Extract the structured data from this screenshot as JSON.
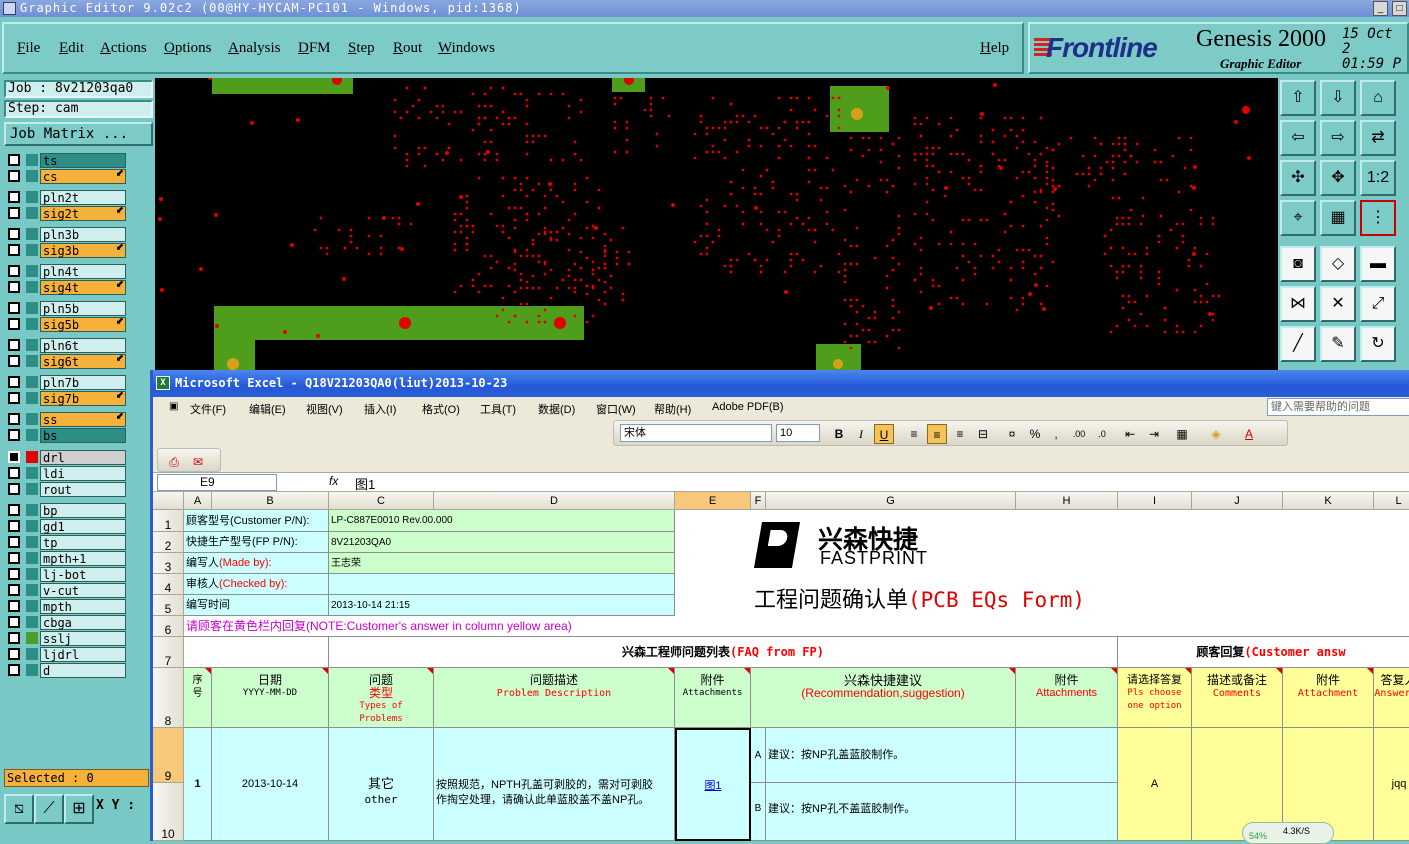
{
  "genesis": {
    "title": "Graphic Editor 9.02c2 (00@HY-HYCAM-PC101 - Windows, pid:1368)",
    "menu": [
      "File",
      "Edit",
      "Actions",
      "Options",
      "Analysis",
      "DFM",
      "Step",
      "Rout",
      "Windows"
    ],
    "help": "Help",
    "brand": "Frontline",
    "product": "Genesis 2000",
    "subtitle": "Graphic Editor",
    "date": "15 Oct 2",
    "time": "01:59 P",
    "job": "Job : 8v21203qa0",
    "step": "Step: cam",
    "job_matrix": "Job Matrix ...",
    "layers": [
      {
        "name": "ts",
        "color": "#2c8e84",
        "arrow": false
      },
      {
        "name": "cs",
        "color": "#f6b13a",
        "arrow": true
      },
      {
        "name": "pln2t",
        "color": "#cfeeee",
        "arrow": false
      },
      {
        "name": "sig2t",
        "color": "#f6b13a",
        "arrow": true
      },
      {
        "name": "pln3b",
        "color": "#cfeeee",
        "arrow": false
      },
      {
        "name": "sig3b",
        "color": "#f6b13a",
        "arrow": true
      },
      {
        "name": "pln4t",
        "color": "#cfeeee",
        "arrow": false
      },
      {
        "name": "sig4t",
        "color": "#f6b13a",
        "arrow": true
      },
      {
        "name": "pln5b",
        "color": "#cfeeee",
        "arrow": false
      },
      {
        "name": "sig5b",
        "color": "#f6b13a",
        "arrow": true
      },
      {
        "name": "pln6t",
        "color": "#cfeeee",
        "arrow": false
      },
      {
        "name": "sig6t",
        "color": "#f6b13a",
        "arrow": true
      },
      {
        "name": "pln7b",
        "color": "#cfeeee",
        "arrow": false
      },
      {
        "name": "sig7b",
        "color": "#f6b13a",
        "arrow": true
      },
      {
        "name": "ss",
        "color": "#f6b13a",
        "arrow": true
      },
      {
        "name": "bs",
        "color": "#2c8e84",
        "arrow": false
      },
      {
        "name": "drl",
        "color": "#cfcfcf",
        "arrow": false,
        "active": true
      },
      {
        "name": "ldi",
        "color": "#cfeeee",
        "arrow": false
      },
      {
        "name": "rout",
        "color": "#cfeeee",
        "arrow": false
      },
      {
        "name": "bp",
        "color": "#cfeeee",
        "arrow": false
      },
      {
        "name": "gd1",
        "color": "#cfeeee",
        "arrow": false
      },
      {
        "name": "tp",
        "color": "#cfeeee",
        "arrow": false
      },
      {
        "name": "mpth+1",
        "color": "#cfeeee",
        "arrow": false
      },
      {
        "name": "lj-bot",
        "color": "#cfeeee",
        "arrow": false
      },
      {
        "name": "v-cut",
        "color": "#cfeeee",
        "arrow": false
      },
      {
        "name": "mpth",
        "color": "#cfeeee",
        "arrow": false
      },
      {
        "name": "cbga",
        "color": "#cfeeee",
        "arrow": false
      },
      {
        "name": "sslj",
        "color": "#cfeeee",
        "arrow": false
      },
      {
        "name": "ljdrl",
        "color": "#cfeeee",
        "arrow": false
      },
      {
        "name": "d",
        "color": "#cfeeee",
        "arrow": false
      }
    ],
    "selected": "Selected : 0",
    "xy": "X Y :"
  },
  "excel": {
    "title": "Microsoft Excel - Q18V21203QA0(liut)2013-10-23",
    "menu": [
      "文件(F)",
      "编辑(E)",
      "视图(V)",
      "插入(I)",
      "格式(O)",
      "工具(T)",
      "数据(D)",
      "窗口(W)",
      "帮助(H)",
      "Adobe PDF(B)"
    ],
    "help_placeholder": "键入需要帮助的问题",
    "font": "宋体",
    "size": "10",
    "namebox": "E9",
    "fx": "fx",
    "formula": "图1",
    "columns": [
      "A",
      "B",
      "C",
      "D",
      "E",
      "F",
      "G",
      "H",
      "I",
      "J",
      "K",
      "L"
    ],
    "rows": [
      "1",
      "2",
      "3",
      "4",
      "5",
      "6",
      "7",
      "8",
      "9",
      "10"
    ],
    "info": [
      {
        "label": "顾客型号(Customer P/N):",
        "value": "LP-C887E0010 Rev.00.000"
      },
      {
        "label": "快捷生产型号(FP P/N):",
        "value": "8V21203QA0"
      },
      {
        "label": "编写人",
        "label_en": "(Made by):",
        "value": "王志荣"
      },
      {
        "label": "审核人",
        "label_en": "(Checked by):",
        "value": ""
      },
      {
        "label": "编写时间",
        "value": "2013-10-14 21:15"
      }
    ],
    "logo_cn": "兴森快捷",
    "logo_en": "FASTPRINT",
    "form_title_cn": "工程问题确认单",
    "form_title_en": "(PCB EQs Form)",
    "note_cn": "请顾客在黄色栏内回复",
    "note_en": "(NOTE:Customer's answer in column yellow area)",
    "faq_cn": "兴森工程师问题列表",
    "faq_en": "(FAQ from FP)",
    "cust_cn": "顾客回复",
    "cust_en": "(Customer answ",
    "headers": {
      "seq_a": "序",
      "seq_b": "号",
      "date_cn": "日期",
      "date_en": "YYYY-MM-DD",
      "type_cn": "问题",
      "type_cn2": "类型",
      "type_en": "Types of",
      "type_en2": "Problems",
      "desc_cn": "问题描述",
      "desc_en": "Problem Description",
      "att_cn": "附件",
      "att_en": "Attachments",
      "sug_cn": "兴森快捷建议",
      "sug_en": "(Recommendation,suggestion)",
      "att2_cn": "附件",
      "att2_en": "Attachments",
      "choose_cn": "请选择答复",
      "choose_en": "Pls choose",
      "choose_en2": "one option",
      "remark_cn": "描述或备注",
      "remark_en": "Comments",
      "att3_cn": "附件",
      "att3_en": "Attachment",
      "ans_cn": "答复人",
      "ans_en": "Answer b"
    },
    "row1": {
      "seq": "1",
      "date": "2013-10-14",
      "type_cn": "其它",
      "type_en": "other",
      "desc": "按照规范，NPTH孔盖可剥胶的，需对可剥胶",
      "desc2": "作掏空处理，请确认此单蓝胶盖不盖NP孔。",
      "attachment": "图1",
      "optA": "A",
      "sugA": "建议：按NP孔盖蓝胶制作。",
      "optB": "B",
      "sugB": "建议：按NP孔不盖蓝胶制作。",
      "choice": "A",
      "answerer": "jqq"
    }
  },
  "net": {
    "percent": "54%",
    "speed": "4.3K/S"
  }
}
